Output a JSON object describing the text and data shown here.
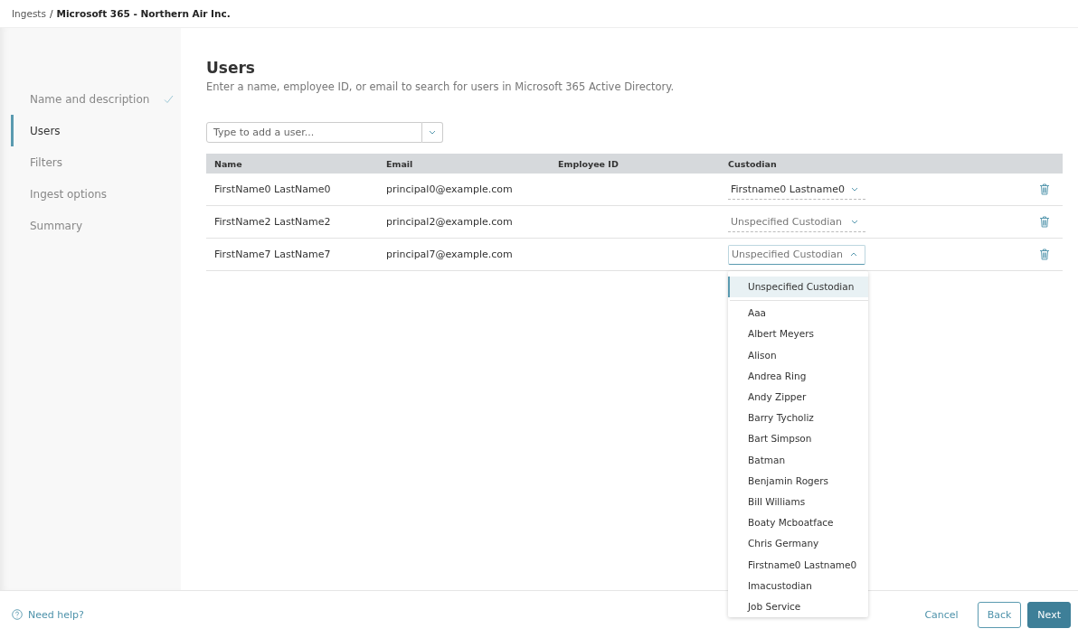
{
  "breadcrumb": {
    "parent": "Ingests",
    "separator": "/",
    "current": "Microsoft 365 - Northern Air Inc."
  },
  "steps": [
    {
      "label": "Name and description",
      "selected": false,
      "done": true
    },
    {
      "label": "Users",
      "selected": true,
      "done": false
    },
    {
      "label": "Filters",
      "selected": false,
      "done": false
    },
    {
      "label": "Ingest options",
      "selected": false,
      "done": false
    },
    {
      "label": "Summary",
      "selected": false,
      "done": false
    }
  ],
  "heading": "Users",
  "description": "Enter a name, employee ID, or email to search for users in Microsoft 365 Active Directory.",
  "user_search": {
    "placeholder": "Type to add a user..."
  },
  "table": {
    "columns": [
      "Name",
      "Email",
      "Employee ID",
      "Custodian"
    ],
    "rows": [
      {
        "name": "FirstName0 LastName0",
        "email": "principal0@example.com",
        "custodian": "Firstname0 Lastname0",
        "unspecified": false,
        "open": false
      },
      {
        "name": "FirstName2 LastName2",
        "email": "principal2@example.com",
        "custodian": "Unspecified Custodian",
        "unspecified": true,
        "open": false
      },
      {
        "name": "FirstName7 LastName7",
        "email": "principal7@example.com",
        "custodian": "Unspecified Custodian",
        "unspecified": true,
        "open": true
      }
    ]
  },
  "custodian_menu": [
    {
      "label": "Unspecified Custodian",
      "selected": true
    },
    {
      "label": "Aaa",
      "selected": false
    },
    {
      "label": "Albert Meyers",
      "selected": false
    },
    {
      "label": "Alison",
      "selected": false
    },
    {
      "label": "Andrea Ring",
      "selected": false
    },
    {
      "label": "Andy Zipper",
      "selected": false
    },
    {
      "label": "Barry Tycholiz",
      "selected": false
    },
    {
      "label": "Bart Simpson",
      "selected": false
    },
    {
      "label": "Batman",
      "selected": false
    },
    {
      "label": "Benjamin Rogers",
      "selected": false
    },
    {
      "label": "Bill Williams",
      "selected": false
    },
    {
      "label": "Boaty Mcboatface",
      "selected": false
    },
    {
      "label": "Chris Germany",
      "selected": false
    },
    {
      "label": "Firstname0 Lastname0",
      "selected": false
    },
    {
      "label": "Imacustodian",
      "selected": false
    },
    {
      "label": "Job Service",
      "selected": false
    }
  ],
  "footer": {
    "help": "Need help?",
    "buttons": [
      "Cancel",
      "Back",
      "Next"
    ]
  }
}
